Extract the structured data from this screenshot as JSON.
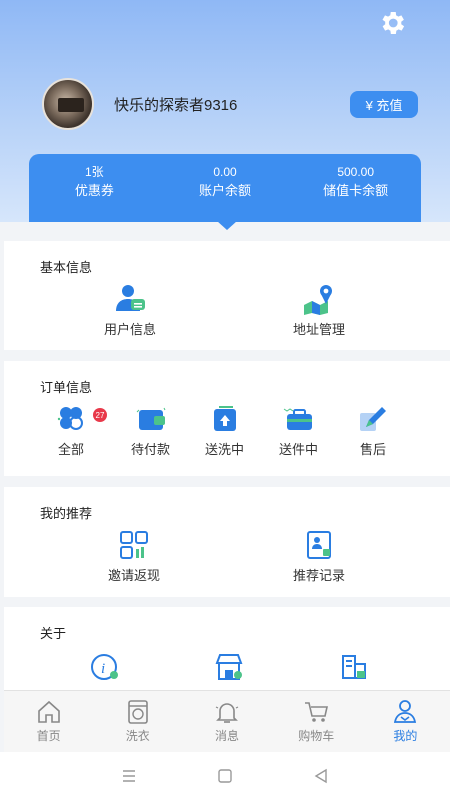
{
  "profile": {
    "username": "快乐的探索者9316",
    "recharge_label": "¥ 充值"
  },
  "stats": [
    {
      "value": "1张",
      "label": "优惠券"
    },
    {
      "value": "0.00",
      "label": "账户余额"
    },
    {
      "value": "500.00",
      "label": "储值卡余额"
    }
  ],
  "basic": {
    "title": "基本信息",
    "items": [
      "用户信息",
      "地址管理"
    ]
  },
  "orders": {
    "title": "订单信息",
    "badge": "27",
    "items": [
      "全部",
      "待付款",
      "送洗中",
      "送件中",
      "售后"
    ]
  },
  "recommend": {
    "title": "我的推荐",
    "items": [
      "邀请返现",
      "推荐记录"
    ]
  },
  "about": {
    "title": "关于"
  },
  "tabbar": [
    {
      "label": "首页",
      "icon": "home-icon"
    },
    {
      "label": "洗衣",
      "icon": "washer-icon"
    },
    {
      "label": "消息",
      "icon": "bell-icon"
    },
    {
      "label": "购物车",
      "icon": "cart-icon"
    },
    {
      "label": "我的",
      "icon": "user-icon",
      "active": true
    }
  ],
  "colors": {
    "accent": "#3d8ef0",
    "active_tab": "#2a7de1",
    "badge": "#e8394a"
  }
}
